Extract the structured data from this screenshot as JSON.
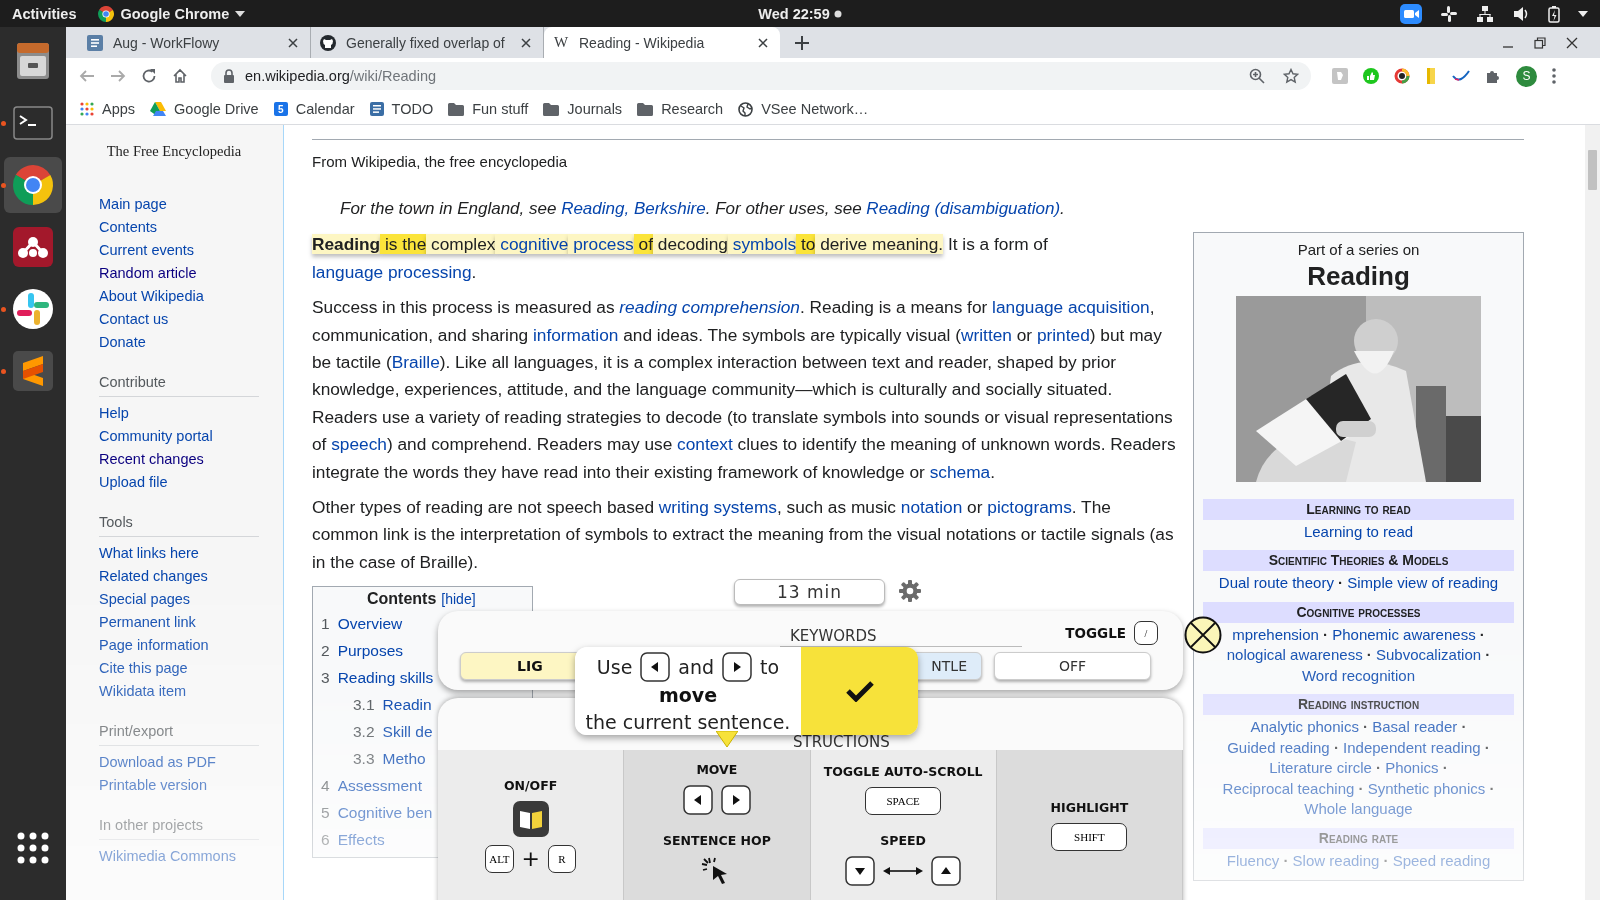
{
  "top_bar": {
    "activities": "Activities",
    "app_menu": "Google Chrome",
    "clock": "Wed 22:59"
  },
  "dock": [
    {
      "kind": "files",
      "running": false,
      "selected": false
    },
    {
      "kind": "terminal",
      "running": true,
      "selected": false
    },
    {
      "kind": "chrome",
      "running": true,
      "selected": true
    },
    {
      "kind": "mendeley",
      "running": false,
      "selected": false
    },
    {
      "kind": "slack",
      "running": true,
      "selected": false
    },
    {
      "kind": "sublime",
      "running": true,
      "selected": false
    },
    {
      "kind": "app-grid",
      "running": false,
      "selected": false
    }
  ],
  "browser": {
    "tabs": [
      {
        "kind": "list",
        "title": "Aug - WorkFlowy",
        "selected": false
      },
      {
        "kind": "circle",
        "title": "Generally fixed overlap of",
        "selected": false
      },
      {
        "kind": "letter",
        "icon_text": "W",
        "title": "Reading - Wikipedia",
        "selected": true
      }
    ],
    "url": {
      "host": "en.wikipedia.org",
      "path": "/wiki/Reading"
    },
    "profile_initial": "S",
    "bookmarks": [
      {
        "kind": "apps",
        "label": "Apps"
      },
      {
        "kind": "drive",
        "label": "Google Drive"
      },
      {
        "kind": "calendar",
        "icon_text": "5",
        "label": "Calendar"
      },
      {
        "kind": "list",
        "label": "TODO"
      },
      {
        "kind": "folder",
        "label": "Fun stuff"
      },
      {
        "kind": "folder",
        "label": "Journals"
      },
      {
        "kind": "folder",
        "label": "Research"
      },
      {
        "kind": "globe",
        "label": "VSee Network…"
      }
    ]
  },
  "wiki_sidebar": {
    "tagline": "The Free Encyclopedia",
    "groups": [
      {
        "items": [
          {
            "text": "Main page",
            "visited": false
          },
          {
            "text": "Contents",
            "visited": false
          },
          {
            "text": "Current events",
            "visited": false
          },
          {
            "text": "Random article",
            "visited": true
          },
          {
            "text": "About Wikipedia",
            "visited": false
          },
          {
            "text": "Contact us",
            "visited": false
          },
          {
            "text": "Donate",
            "visited": false
          }
        ]
      },
      {
        "heading": "Contribute",
        "items": [
          {
            "text": "Help",
            "visited": false
          },
          {
            "text": "Community portal",
            "visited": false
          },
          {
            "text": "Recent changes",
            "visited": true
          },
          {
            "text": "Upload file",
            "visited": false
          }
        ]
      },
      {
        "heading": "Tools",
        "items": [
          {
            "text": "What links here",
            "visited": false
          },
          {
            "text": "Related changes",
            "visited": false
          },
          {
            "text": "Special pages",
            "visited": false
          },
          {
            "text": "Permanent link",
            "visited": false
          },
          {
            "text": "Page information",
            "visited": false
          },
          {
            "text": "Cite this page",
            "visited": false
          },
          {
            "text": "Wikidata item",
            "visited": false
          }
        ]
      },
      {
        "heading": "Print/export",
        "items": [
          {
            "text": "Download as PDF",
            "visited": false
          },
          {
            "text": "Printable version",
            "visited": false
          }
        ]
      },
      {
        "heading": "In other projects",
        "items": [
          {
            "text": "Wikimedia Commons",
            "visited": false
          }
        ]
      }
    ]
  },
  "article": {
    "tagline": "From Wikipedia, the free encyclopedia",
    "hatnote": [
      {
        "kind": "text",
        "text": "For the town in England, see "
      },
      {
        "kind": "link",
        "text": "Reading, Berkshire"
      },
      {
        "kind": "text",
        "text": ". For other uses, see "
      },
      {
        "kind": "link",
        "text": "Reading (disambiguation)"
      },
      {
        "kind": "text",
        "text": "."
      }
    ],
    "paragraphs": [
      [
        {
          "kind": "text",
          "text": "Reading",
          "bold": true,
          "highlighted": true,
          "strong": false
        },
        {
          "kind": "text",
          "text": " is the",
          "highlighted": true,
          "strong": true
        },
        {
          "kind": "text",
          "text": " complex",
          "highlighted": true,
          "strong": false
        },
        {
          "kind": "link",
          "text": " cognitive",
          "highlighted": true,
          "strong": false
        },
        {
          "kind": "link",
          "text": " process",
          "highlighted": true,
          "strong": false
        },
        {
          "kind": "text",
          "text": " of",
          "highlighted": true,
          "strong": true
        },
        {
          "kind": "text",
          "text": " decoding",
          "highlighted": true,
          "strong": false
        },
        {
          "kind": "link",
          "text": " symbols",
          "highlighted": true,
          "strong": false
        },
        {
          "kind": "text",
          "text": " to",
          "highlighted": true,
          "strong": true
        },
        {
          "kind": "text",
          "text": " derive meaning.",
          "highlighted": true,
          "strong": false
        },
        {
          "kind": "text",
          "text": " It is a form of ",
          "highlighted": false
        },
        {
          "kind": "link",
          "text": "language",
          "highlighted": false
        },
        {
          "kind": "link",
          "text": " processing",
          "highlighted": false
        },
        {
          "kind": "text",
          "text": ".",
          "highlighted": false
        }
      ],
      [
        {
          "kind": "text",
          "text": "Success in this process is measured as "
        },
        {
          "kind": "link",
          "text": "reading comprehension",
          "italic": true
        },
        {
          "kind": "text",
          "text": ". Reading is a means for "
        },
        {
          "kind": "link",
          "text": "language acquisition"
        },
        {
          "kind": "text",
          "text": ", communication, and sharing "
        },
        {
          "kind": "link",
          "text": "information"
        },
        {
          "kind": "text",
          "text": " and ideas. The symbols are typically visual ("
        },
        {
          "kind": "link",
          "text": "written"
        },
        {
          "kind": "text",
          "text": " or "
        },
        {
          "kind": "link",
          "text": "printed"
        },
        {
          "kind": "text",
          "text": ") but may be tactile ("
        },
        {
          "kind": "link",
          "text": "Braille"
        },
        {
          "kind": "text",
          "text": "). Like all languages, it is a complex interaction between text and reader, shaped by prior knowledge, experiences, attitude, and the language community—which is culturally and socially situated. Readers use a variety of reading strategies to decode (to translate symbols into sounds or visual representations of "
        },
        {
          "kind": "link",
          "text": "speech"
        },
        {
          "kind": "text",
          "text": ") and comprehend. Readers may use "
        },
        {
          "kind": "link",
          "text": "context"
        },
        {
          "kind": "text",
          "text": " clues to identify the meaning of unknown words. Readers integrate the words they have read into their existing framework of knowledge or "
        },
        {
          "kind": "link",
          "text": "schema"
        },
        {
          "kind": "text",
          "text": "."
        }
      ],
      [
        {
          "kind": "text",
          "text": "Other types of reading are not speech based "
        },
        {
          "kind": "link",
          "text": "writing systems"
        },
        {
          "kind": "text",
          "text": ", such as music "
        },
        {
          "kind": "link",
          "text": "notation"
        },
        {
          "kind": "text",
          "text": " or "
        },
        {
          "kind": "link",
          "text": "pictograms"
        },
        {
          "kind": "text",
          "text": ". The common link is the interpretation of symbols to extract the meaning from the visual notations or tactile signals (as in the case of Braille)."
        }
      ]
    ],
    "toc": {
      "title": "Contents",
      "toggle": "[hide]",
      "items": [
        {
          "number": "1",
          "text": "Overview"
        },
        {
          "number": "2",
          "text": "Purposes"
        },
        {
          "number": "3",
          "text": "Reading skills",
          "children": [
            {
              "number": "3.1",
              "text": "Readin"
            },
            {
              "number": "3.2",
              "text": "Skill de"
            },
            {
              "number": "3.3",
              "text": "Metho"
            }
          ]
        },
        {
          "number": "4",
          "text": "Assessment"
        },
        {
          "number": "5",
          "text": "Cognitive ben"
        },
        {
          "number": "6",
          "text": "Effects"
        }
      ]
    },
    "infobox": {
      "series": "Part of a series on",
      "title": "Reading",
      "separator": "·",
      "sections": [
        {
          "heading": "Learning to read",
          "links": [
            "Learning to read"
          ]
        },
        {
          "heading": "Scientific Theories & Models",
          "links": [
            "Dual route theory",
            "Simple view of reading"
          ]
        },
        {
          "heading": "Cognitive processes",
          "links": [
            "mprehension",
            "Phonemic awareness",
            "nological awareness",
            "Subvocalization",
            "Word recognition"
          ]
        },
        {
          "heading": "Reading instruction",
          "links": [
            "Analytic phonics",
            "Basal reader",
            "Guided reading",
            "Independent reading",
            "Literature circle",
            "Phonics",
            "Reciprocal teaching",
            "Synthetic phonics",
            "Whole language"
          ]
        },
        {
          "heading": "Reading rate",
          "links": [
            "Fluency",
            "Slow reading",
            "Speed reading"
          ]
        }
      ]
    }
  },
  "reader_overlay": {
    "timer": "13 min",
    "keywords": {
      "title": "KEYWORDS",
      "toggle_label": "TOGGLE",
      "toggle_key": "/",
      "options": [
        {
          "label": "LIG",
          "color": "#fdf6c3"
        },
        {
          "label": "NTLE",
          "color": "#deecf9"
        },
        {
          "label": "OFF",
          "color": "#ffffff"
        }
      ]
    },
    "tooltip": {
      "parts": [
        {
          "kind": "text",
          "text": "Use"
        },
        {
          "kind": "left-key"
        },
        {
          "kind": "text",
          "text": "and"
        },
        {
          "kind": "right-key"
        },
        {
          "kind": "text",
          "text": "to"
        }
      ],
      "emphasis": "move",
      "rest": "the current sentence."
    },
    "instructions": {
      "title": "STRUCTIONS",
      "columns": [
        {
          "shaded": false,
          "groups": [
            {
              "label": "ON/OFF",
              "controls": [
                {
                  "kind": "book"
                },
                {
                  "kind": "keys",
                  "keys": [
                    {
                      "kind": "key",
                      "label": "ALT",
                      "wide": false
                    },
                    {
                      "kind": "plus",
                      "text": "+"
                    },
                    {
                      "kind": "key",
                      "label": "R",
                      "wide": false
                    }
                  ]
                }
              ]
            }
          ]
        },
        {
          "shaded": true,
          "groups": [
            {
              "label": "MOVE",
              "controls": [
                {
                  "kind": "keys",
                  "keys": [
                    {
                      "kind": "left-key"
                    },
                    {
                      "kind": "right-key"
                    }
                  ]
                }
              ]
            },
            {
              "label": "SENTENCE HOP",
              "controls": [
                {
                  "kind": "click"
                }
              ]
            }
          ]
        },
        {
          "shaded": false,
          "groups": [
            {
              "label": "TOGGLE AUTO-SCROLL",
              "controls": [
                {
                  "kind": "keys",
                  "keys": [
                    {
                      "kind": "key",
                      "label": "SPACE",
                      "wide": true
                    }
                  ]
                }
              ]
            },
            {
              "label": "SPEED",
              "controls": [
                {
                  "kind": "keys",
                  "keys": [
                    {
                      "kind": "down-key"
                    },
                    {
                      "kind": "range"
                    },
                    {
                      "kind": "up-key"
                    }
                  ]
                }
              ]
            }
          ]
        },
        {
          "shaded": true,
          "groups": [
            {
              "label": "HIGHLIGHT",
              "controls": [
                {
                  "kind": "keys",
                  "keys": [
                    {
                      "kind": "key",
                      "label": "SHIFT",
                      "wide": true
                    }
                  ]
                }
              ]
            }
          ]
        }
      ]
    }
  }
}
